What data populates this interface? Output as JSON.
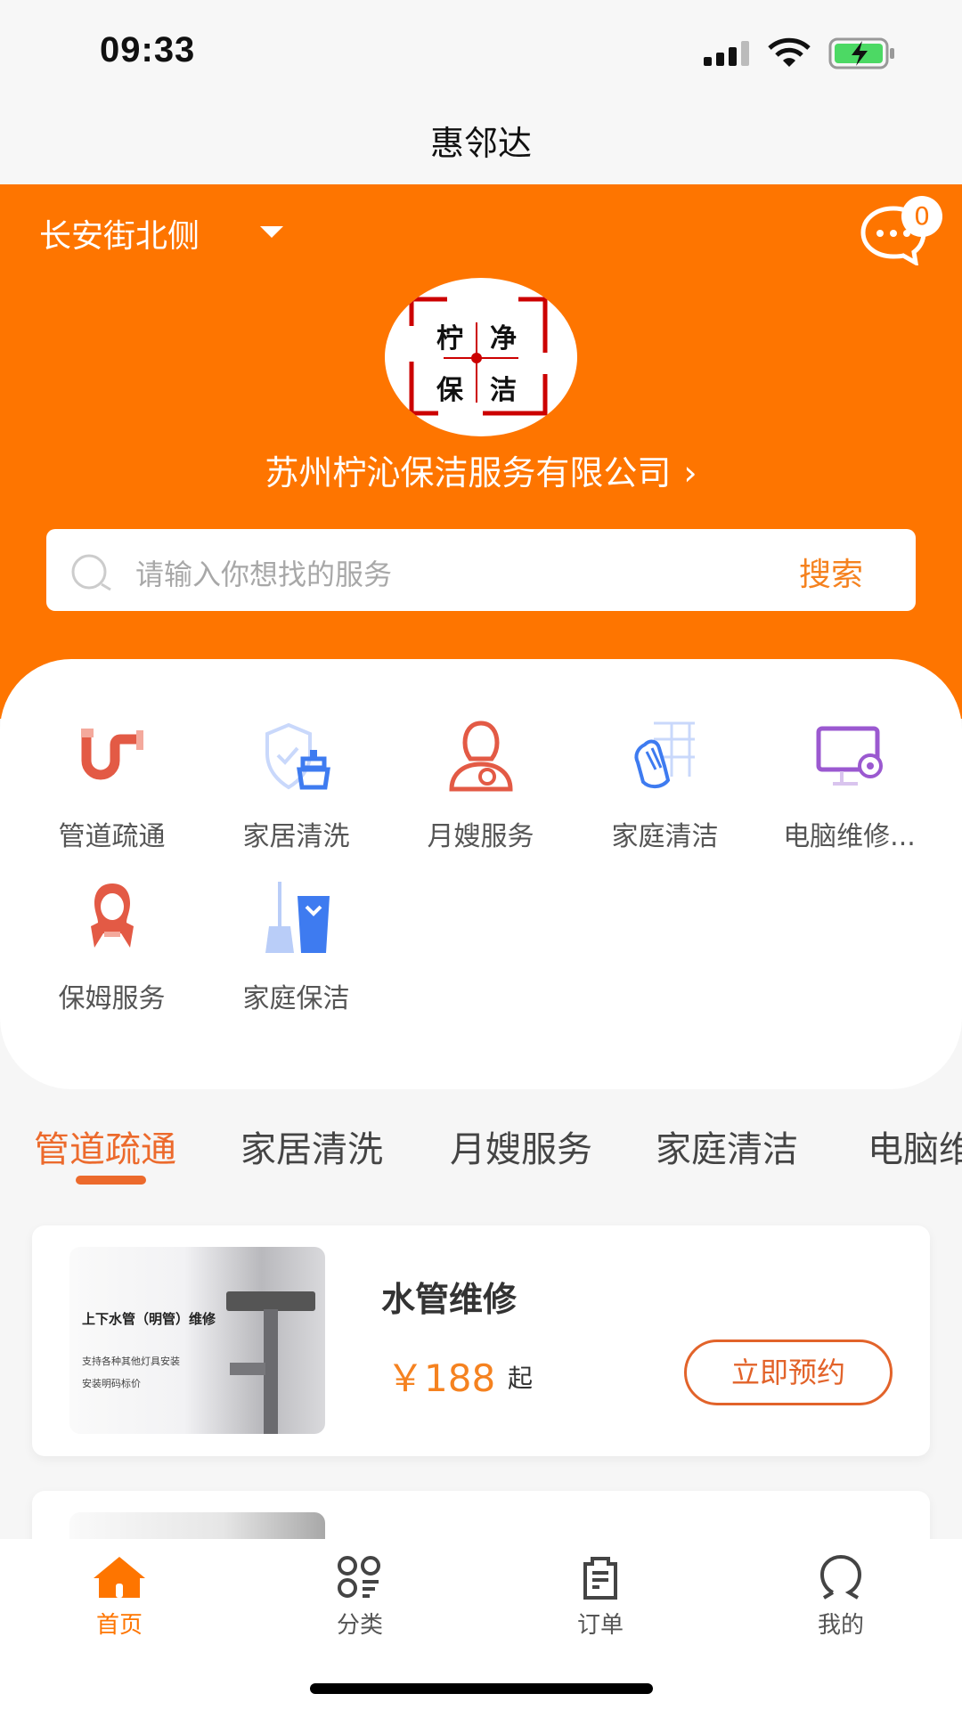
{
  "status_bar": {
    "time": "09:33"
  },
  "header": {
    "title": "惠邻达"
  },
  "location": {
    "label": "长安街北侧"
  },
  "messages": {
    "badge_count": "0"
  },
  "company": {
    "logo_chars": [
      "柠",
      "净",
      "保",
      "洁"
    ],
    "name": "苏州柠沁保洁服务有限公司"
  },
  "search": {
    "placeholder": "请输入你想找的服务",
    "button": "搜索"
  },
  "categories": [
    {
      "label": "管道疏通",
      "icon": "pipe-icon"
    },
    {
      "label": "家居清洗",
      "icon": "shield-broom-icon"
    },
    {
      "label": "月嫂服务",
      "icon": "nanny-baby-icon"
    },
    {
      "label": "家庭清洁",
      "icon": "wipe-hand-icon"
    },
    {
      "label": "电脑维修...",
      "icon": "computer-gear-icon"
    },
    {
      "label": "保姆服务",
      "icon": "maid-icon"
    },
    {
      "label": "家庭保洁",
      "icon": "mop-bucket-icon"
    }
  ],
  "tabs": [
    {
      "label": "管道疏通",
      "active": true
    },
    {
      "label": "家居清洗"
    },
    {
      "label": "月嫂服务"
    },
    {
      "label": "家庭清洁"
    },
    {
      "label": "电脑维修"
    }
  ],
  "products": [
    {
      "image_text": {
        "title": "上下水管（明管）维修",
        "lines": [
          "支持各种其他灯具安装",
          "安装明码标价"
        ]
      },
      "title": "水管维修",
      "price": "￥188",
      "price_suffix": "起",
      "button": "立即预约"
    }
  ],
  "tabbar": [
    {
      "label": "首页",
      "active": true
    },
    {
      "label": "分类"
    },
    {
      "label": "订单"
    },
    {
      "label": "我的"
    }
  ],
  "colors": {
    "brand": "#fe7500",
    "accent": "#ec6a2c",
    "price": "#f58220"
  }
}
